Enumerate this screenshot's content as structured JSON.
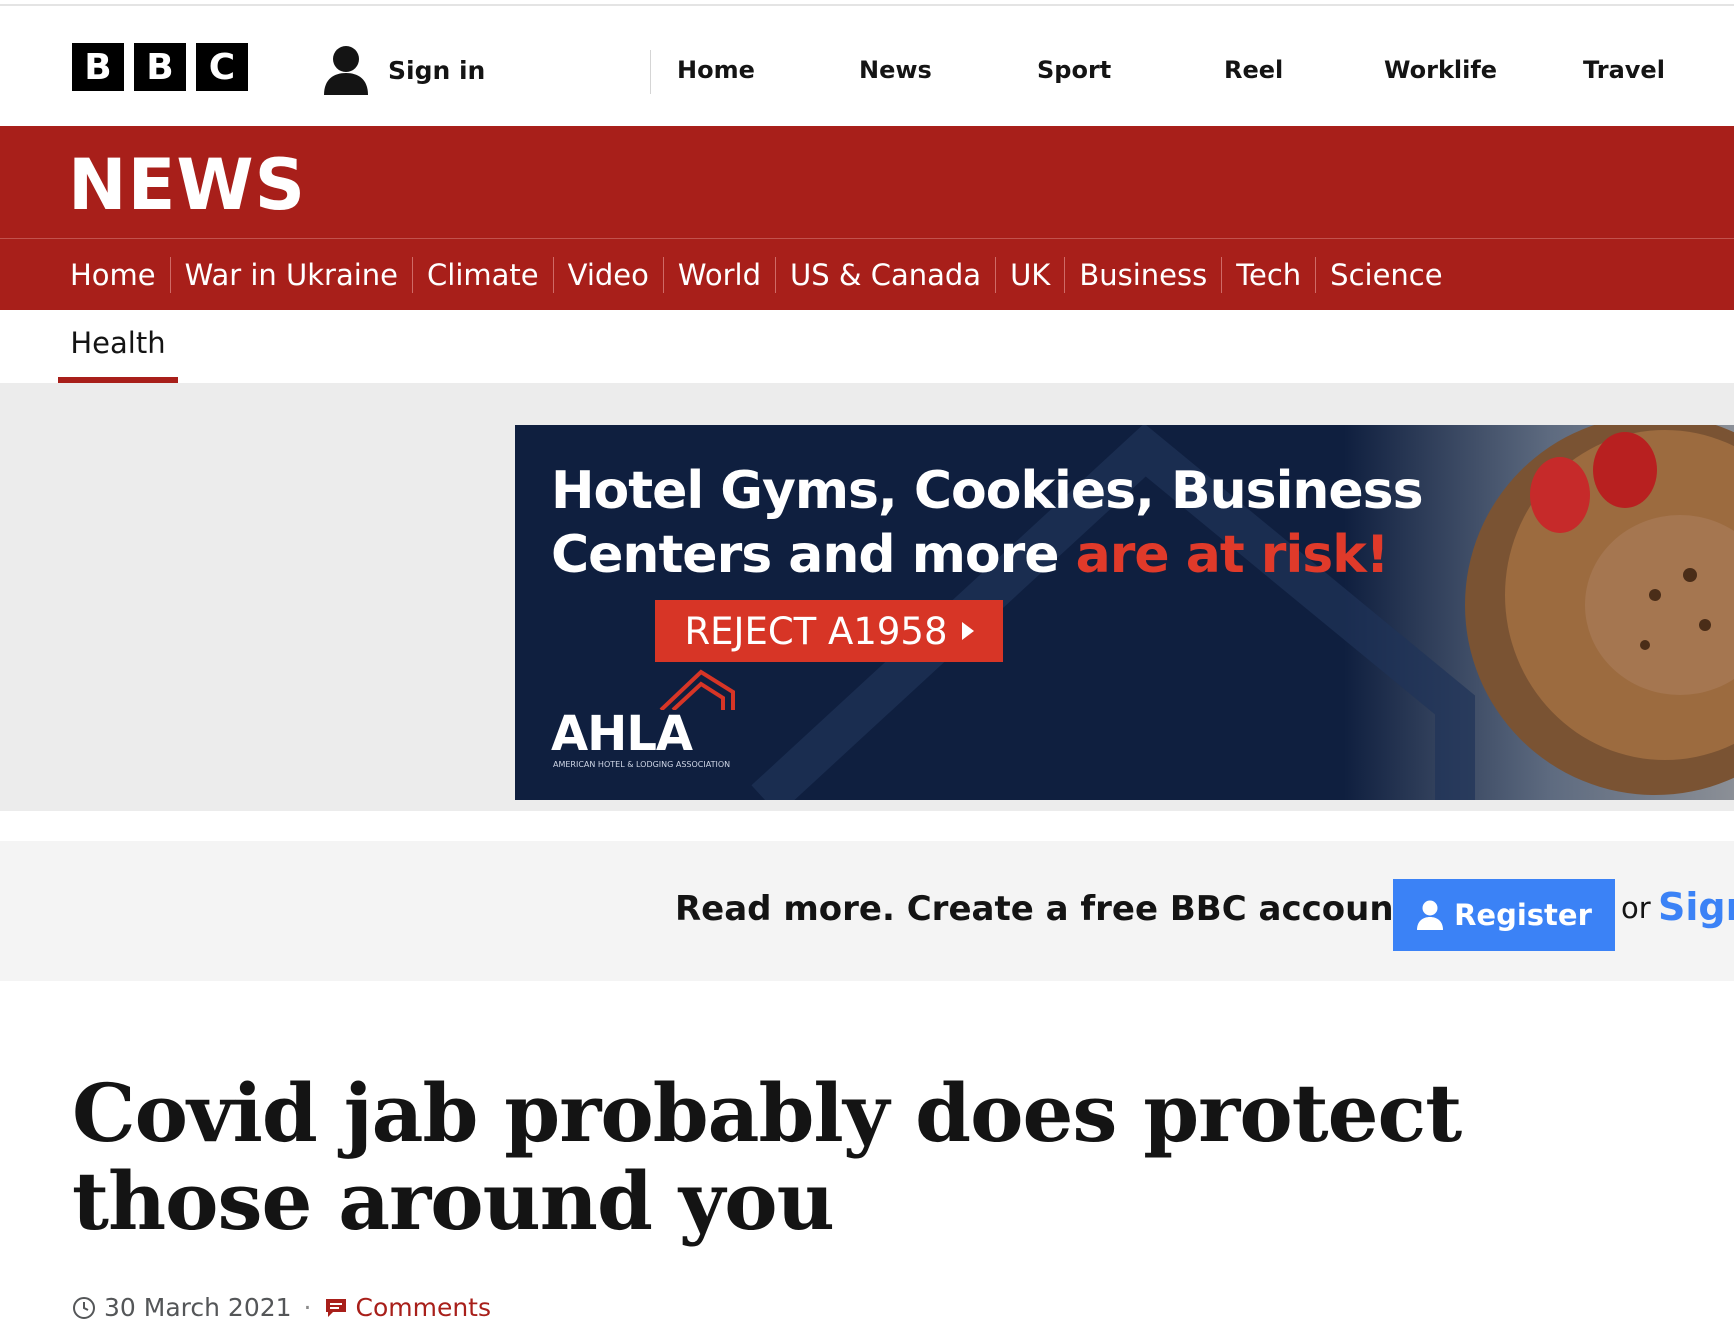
{
  "header": {
    "logo_letters": [
      "B",
      "B",
      "C"
    ],
    "signin_label": "Sign in",
    "nav": [
      "Home",
      "News",
      "Sport",
      "Reel",
      "Worklife",
      "Travel"
    ]
  },
  "news_bar": {
    "wordmark": "NEWS",
    "nav": [
      "Home",
      "War in Ukraine",
      "Climate",
      "Video",
      "World",
      "US & Canada",
      "UK",
      "Business",
      "Tech",
      "Science"
    ],
    "sub_nav": "Health"
  },
  "ad": {
    "headline_line1": "Hotel Gyms, Cookies, Business",
    "headline_line2_white": "Centers and more ",
    "headline_line2_red": "are at risk!",
    "cta_label": "REJECT A1958",
    "logo_text": "AHLA",
    "logo_subtext": "AMERICAN HOTEL & LODGING ASSOCIATION",
    "colors": {
      "background": "#0f1f3f",
      "accent": "#d73526"
    }
  },
  "register_banner": {
    "text": "Read more. Create a free BBC account.",
    "button_label": "Register",
    "or_text": "or",
    "signin_label": "Sign in"
  },
  "article": {
    "headline": "Covid jab probably does protect those around you",
    "date": "30 March 2021",
    "comments_label": "Comments"
  },
  "colors": {
    "bbc_red": "#a81f1a",
    "register_blue": "#3b82f6"
  }
}
